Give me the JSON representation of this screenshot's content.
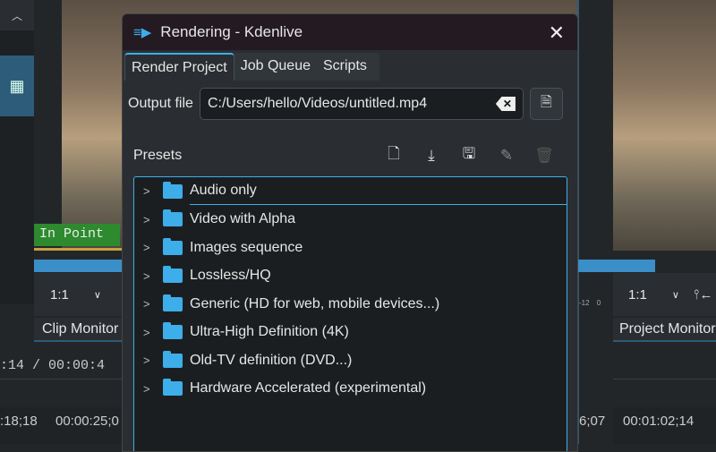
{
  "background": {
    "in_point_label": "In Point",
    "clip_monitor": {
      "zoom": "1:1",
      "tab_label": "Clip Monitor"
    },
    "project_monitor": {
      "zoom": "1:1",
      "tab_label": "Project Monitor",
      "meter_labels": [
        "-12",
        "0"
      ]
    },
    "timecode": ":14 / 00:00:4",
    "ruler_left": [
      ":18;18",
      "00:00:25;0"
    ],
    "ruler_right": [
      "6;07",
      "00:01:02;14"
    ]
  },
  "dialog": {
    "title": "Rendering - Kdenlive",
    "tabs": [
      {
        "label": "Render Project",
        "active": true
      },
      {
        "label": "Job Queue"
      },
      {
        "label": "Scripts"
      }
    ],
    "output_file_label": "Output file",
    "output_file_value": "C:/Users/hello/Videos/untitled.mp4",
    "presets_label": "Presets",
    "presets": [
      "Audio only",
      "Video with Alpha",
      "Images sequence",
      "Lossless/HQ",
      "Generic (HD for web, mobile devices...)",
      "Ultra-High Definition (4K)",
      "Old-TV definition (DVD...)",
      "Hardware Accelerated (experimental)"
    ]
  },
  "colors": {
    "accent": "#3daee9",
    "titlebar": "#241a22",
    "in_point": "#2e8a2e"
  }
}
